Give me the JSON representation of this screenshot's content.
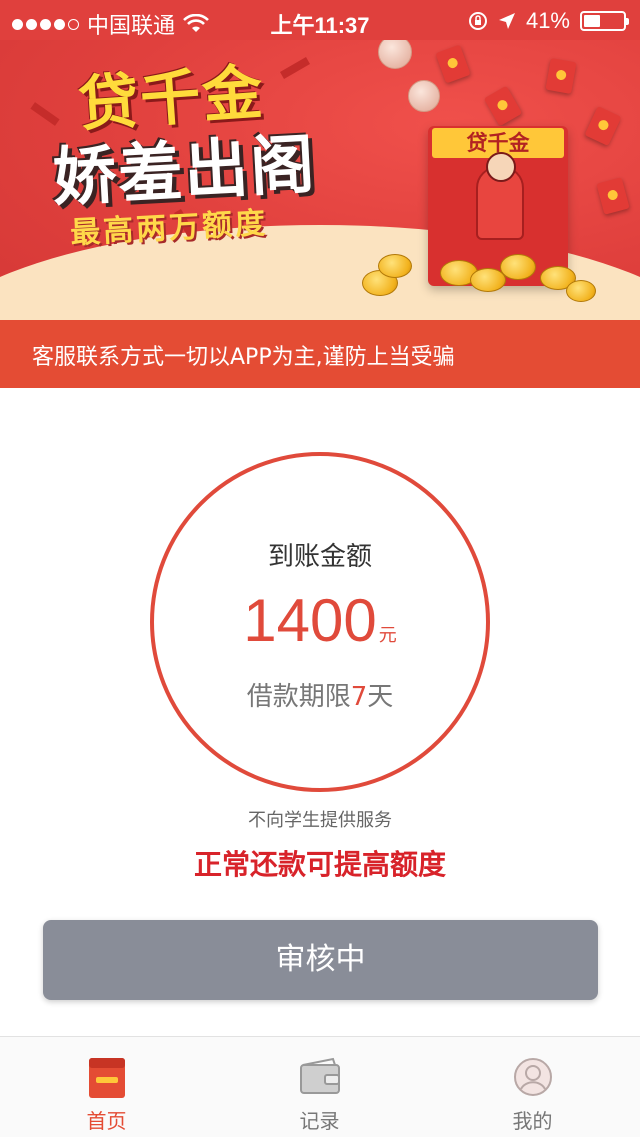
{
  "status_bar": {
    "carrier": "中国联通",
    "time": "上午11:37",
    "battery_pct": "41%",
    "battery_level": 0.41
  },
  "banner": {
    "brand_title": "贷千金",
    "slogan": "娇羞出阁",
    "limit_text": "最高两万额度",
    "card_tag": "贷千金"
  },
  "notice": {
    "text": "客服联系方式一切以APP为主,谨防上当受骗"
  },
  "loan": {
    "amount_label": "到账金额",
    "amount": "1400",
    "amount_unit": "元",
    "term_prefix": "借款期限",
    "term_days": "7",
    "term_suffix": "天"
  },
  "notes": {
    "no_students": "不向学生提供服务",
    "repay_tip": "正常还款可提高额度"
  },
  "action": {
    "status_button": "审核中"
  },
  "tabs": [
    {
      "label": "首页",
      "icon": "home-card-icon",
      "active": true
    },
    {
      "label": "记录",
      "icon": "wallet-icon",
      "active": false
    },
    {
      "label": "我的",
      "icon": "user-profile-icon",
      "active": false
    }
  ],
  "colors": {
    "brand_red": "#e0403d",
    "notice_red": "#e44c34",
    "button_gray": "#898d98"
  }
}
